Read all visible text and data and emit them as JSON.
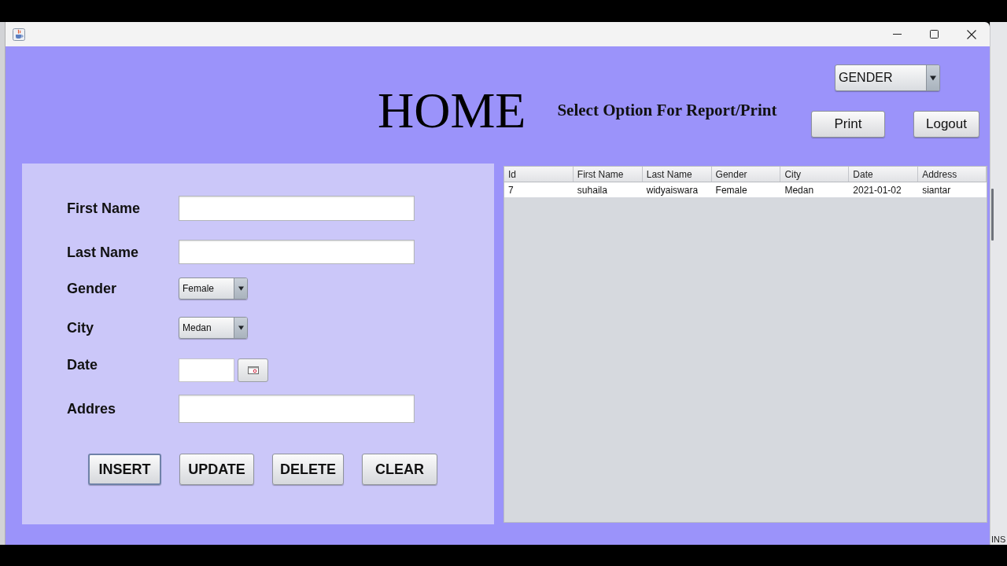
{
  "header": {
    "title": "HOME",
    "subtitle": "Select Option For Report/Print",
    "report_select": {
      "value": "GENDER"
    },
    "buttons": [
      {
        "label": "Print"
      },
      {
        "label": "Logout"
      }
    ]
  },
  "form": {
    "fields": [
      {
        "label": "First Name",
        "kind": "text"
      },
      {
        "label": "Last Name",
        "kind": "text"
      },
      {
        "label": "Gender",
        "kind": "select",
        "value": "Female"
      },
      {
        "label": "City",
        "kind": "select",
        "value": "Medan"
      },
      {
        "label": "Date",
        "kind": "date"
      },
      {
        "label": "Addres",
        "kind": "text"
      }
    ],
    "buttons": [
      {
        "label": "INSERT",
        "focused": true
      },
      {
        "label": "UPDATE",
        "focused": false
      },
      {
        "label": "DELETE",
        "focused": false
      },
      {
        "label": "CLEAR",
        "focused": false
      }
    ]
  },
  "table": {
    "columns": [
      "Id",
      "First Name",
      "Last Name",
      "Gender",
      "City",
      "Date",
      "Address"
    ],
    "rows": [
      [
        "7",
        "suhaila",
        "widyaiswara",
        "Female",
        "Medan",
        "2021-01-02",
        "siantar"
      ]
    ]
  },
  "status_bar": {
    "mode": "INS"
  }
}
